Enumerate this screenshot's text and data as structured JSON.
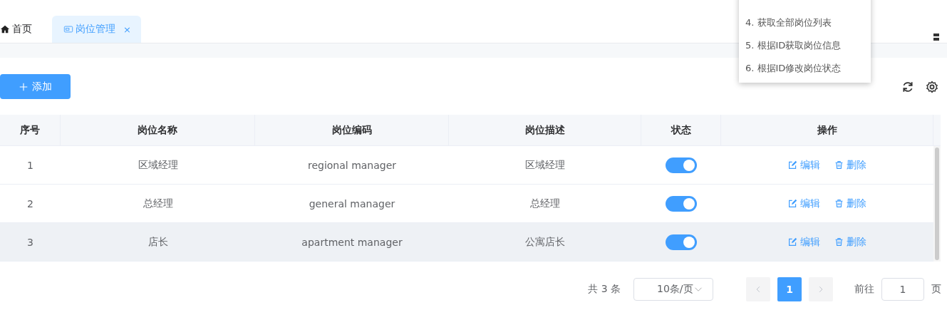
{
  "tabs": [
    {
      "label": "首页",
      "kind": "home",
      "selected": false,
      "closable": false
    },
    {
      "label": "岗位管理",
      "kind": "page",
      "selected": true,
      "closable": true
    }
  ],
  "close_symbol": "×",
  "menu": {
    "items": [
      "4. 获取全部岗位列表",
      "5. 根据ID获取岗位信息",
      "6. 根据ID修改岗位状态"
    ]
  },
  "toolbar": {
    "add_button": "添加"
  },
  "table": {
    "columns": [
      "序号",
      "岗位名称",
      "岗位编码",
      "岗位描述",
      "状态",
      "操作"
    ],
    "rows": [
      {
        "index": "1",
        "name": "区域经理",
        "code": "regional manager",
        "description": "区域经理",
        "on": true,
        "highlighted": false,
        "actions": [
          "编辑",
          "删除"
        ]
      },
      {
        "index": "2",
        "name": "总经理",
        "code": "general manager",
        "description": "总经理",
        "on": true,
        "highlighted": false,
        "actions": [
          "编辑",
          "删除"
        ]
      },
      {
        "index": "3",
        "name": "店长",
        "code": "apartment manager",
        "description": "公寓店长",
        "on": true,
        "highlighted": true,
        "actions": [
          "编辑",
          "删除"
        ]
      }
    ]
  },
  "pagination": {
    "total": "共 3 条",
    "page_size": "10条/页",
    "pages": [
      {
        "label": "1",
        "selected": true
      }
    ],
    "goto_label": "前往",
    "goto_value": "1",
    "page_unit": "页"
  }
}
